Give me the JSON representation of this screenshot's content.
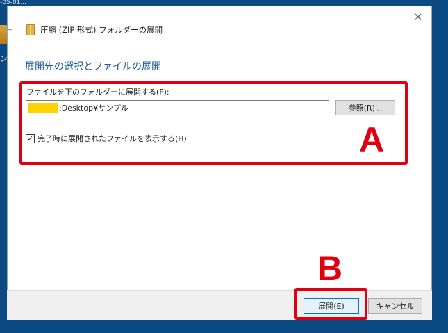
{
  "desktop": {
    "top_text": "-05-01...",
    "icon_label": "ン"
  },
  "dialog": {
    "close_glyph": "✕",
    "back_glyph": "←",
    "title": "圧縮 (ZIP 形式) フォルダーの展開",
    "heading": "展開先の選択とファイルの展開",
    "folder_label": "ファイルを下のフォルダーに展開する(F):",
    "path_value": ":Desktop¥サンプル",
    "browse_label": "参照(R)...",
    "checkbox_checked": true,
    "checkbox_glyph": "✓",
    "checkbox_label": "完了時に展開されたファイルを表示する(H)",
    "extract_label": "展開(E)",
    "cancel_label": "キャンセル"
  },
  "annotations": {
    "a_letter": "A",
    "b_letter": "B",
    "color": "#e00012"
  },
  "colors": {
    "desktop_bg": "#0b4a82",
    "heading": "#1e5aa0",
    "primary_border": "#0078d7",
    "redaction": "#ffd200"
  },
  "icons": [
    "close-icon",
    "back-arrow-icon",
    "zip-folder-icon",
    "checkmark-icon"
  ]
}
